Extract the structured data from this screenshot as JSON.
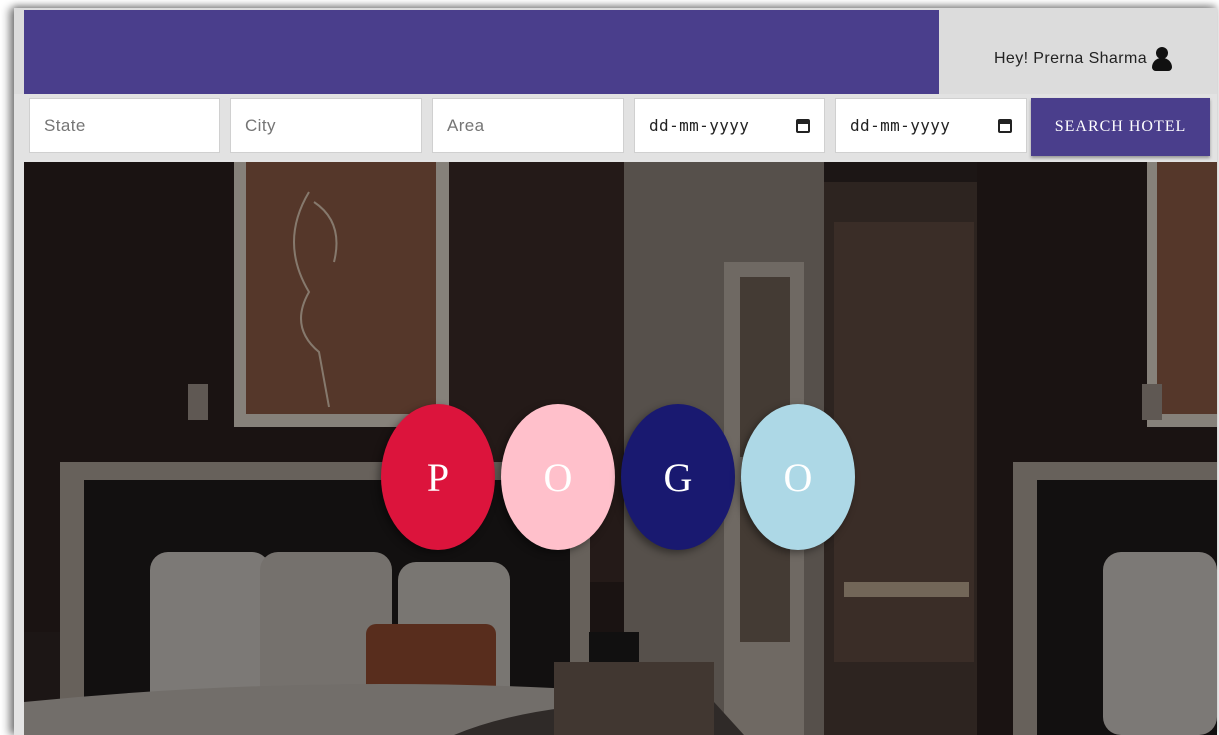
{
  "header": {
    "greeting": "Hey! Prerna Sharma",
    "brand_color": "#4a3e8c",
    "user_icon": "user-icon"
  },
  "search": {
    "state_placeholder": "State",
    "city_placeholder": "City",
    "area_placeholder": "Area",
    "checkin_value": "dd-mm-yyyy",
    "checkout_value": "dd-mm-yyyy",
    "calendar_icon": "calendar-icon",
    "button_label": "SEARCH HOTEL"
  },
  "hero": {
    "logo_letters": [
      {
        "letter": "P",
        "color": "#dc143c"
      },
      {
        "letter": "O",
        "color": "#ffc0cb"
      },
      {
        "letter": "G",
        "color": "#191970"
      },
      {
        "letter": "O",
        "color": "#add8e6"
      }
    ]
  }
}
